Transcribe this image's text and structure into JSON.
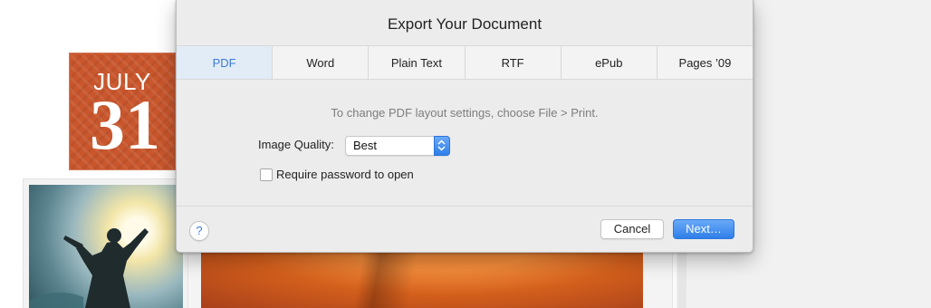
{
  "background": {
    "date_month": "JULY",
    "date_day": "31"
  },
  "dialog": {
    "title": "Export Your Document",
    "tabs": [
      {
        "label": "PDF",
        "active": true
      },
      {
        "label": "Word",
        "active": false
      },
      {
        "label": "Plain Text",
        "active": false
      },
      {
        "label": "RTF",
        "active": false
      },
      {
        "label": "ePub",
        "active": false
      },
      {
        "label": "Pages ’09",
        "active": false
      }
    ],
    "hint": "To change PDF layout settings, choose File > Print.",
    "image_quality": {
      "label": "Image Quality:",
      "value": "Best"
    },
    "password": {
      "label": "Require password to open",
      "checked": false
    },
    "help_label": "?",
    "cancel_label": "Cancel",
    "next_label": "Next…"
  },
  "colors": {
    "accent": "#3a7bd5",
    "badge": "#c9562c"
  },
  "icons": {
    "help": "help-icon",
    "select_arrows": "chevron-updown-icon"
  }
}
